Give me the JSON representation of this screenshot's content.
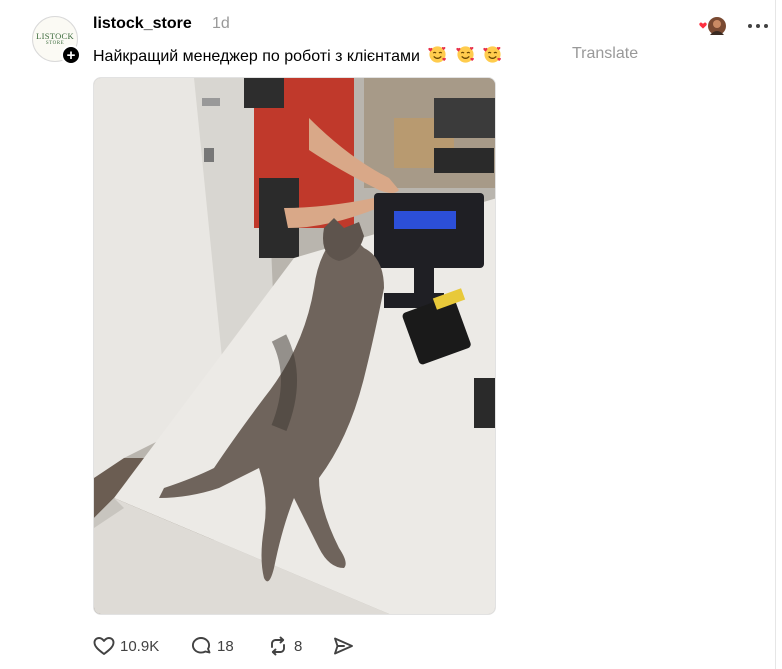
{
  "post": {
    "avatar": {
      "logo_line1": "LISTOCK",
      "logo_line2": "STORE"
    },
    "follow_badge": "+",
    "username": "listock_store",
    "time": "1d",
    "text": "Найкращий менеджер по роботі з клієнтами",
    "emojis": [
      "smiling-face-with-hearts",
      "smiling-face-with-hearts",
      "smiling-face-with-hearts"
    ],
    "translate_label": "Translate",
    "image": {
      "subject": "photo"
    },
    "actions": {
      "like_count": "10.9K",
      "reply_count": "18",
      "repost_count": "8"
    }
  },
  "icons": {
    "like": "heart-icon",
    "reply": "speech-bubble-icon",
    "repost": "repost-arrows-icon",
    "share": "paper-plane-icon",
    "more": "three-dots-icon"
  },
  "colors": {
    "text": "#000000",
    "muted": "#999999",
    "action": "#424242",
    "reaction_heart": "#ff3040"
  }
}
